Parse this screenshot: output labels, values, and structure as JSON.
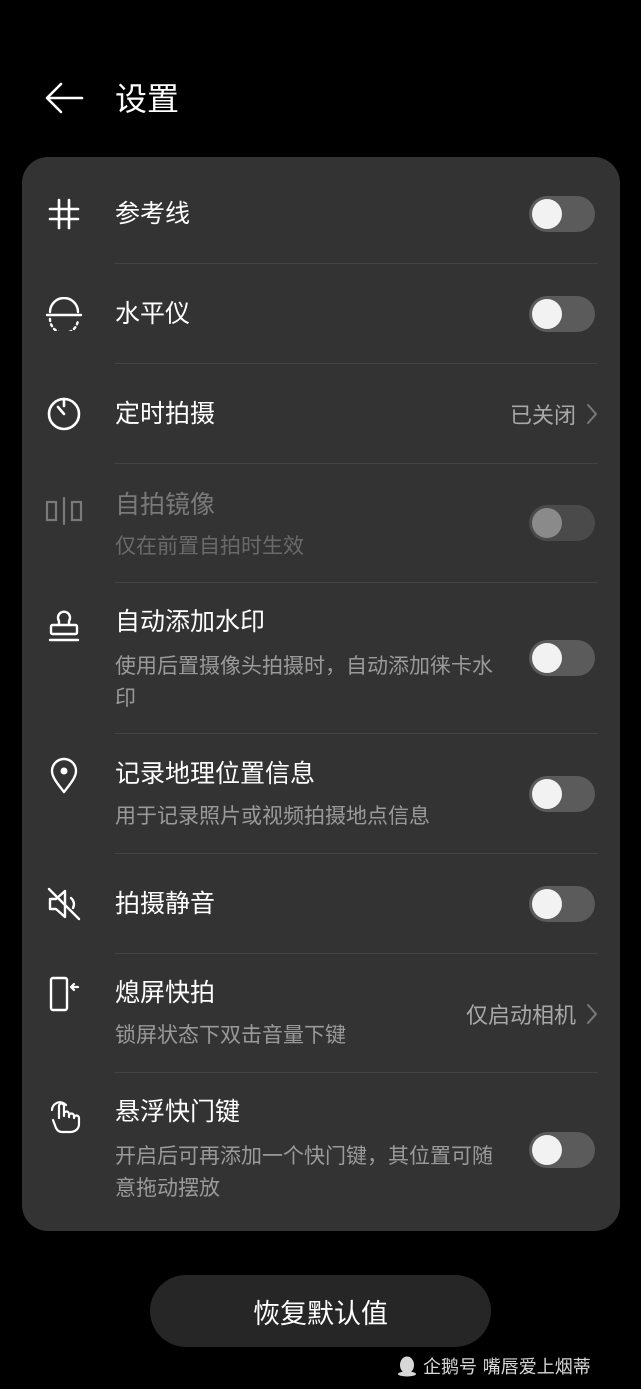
{
  "header": {
    "title": "设置"
  },
  "settings": {
    "reference_lines": {
      "label": "参考线",
      "icon": "grid-icon",
      "enabled": false
    },
    "level": {
      "label": "水平仪",
      "icon": "level-icon",
      "enabled": false
    },
    "timer": {
      "label": "定时拍摄",
      "icon": "timer-icon",
      "value": "已关闭"
    },
    "selfie_mirror": {
      "label": "自拍镜像",
      "sub": "仅在前置自拍时生效",
      "icon": "mirror-icon",
      "enabled": false,
      "disabled": true
    },
    "auto_watermark": {
      "label": "自动添加水印",
      "sub": "使用后置摄像头拍摄时，自动添加徕卡水印",
      "icon": "stamp-icon",
      "enabled": false
    },
    "location": {
      "label": "记录地理位置信息",
      "sub": "用于记录照片或视频拍摄地点信息",
      "icon": "location-pin-icon",
      "enabled": false
    },
    "mute": {
      "label": "拍摄静音",
      "icon": "mute-speaker-icon",
      "enabled": false
    },
    "quick_snap": {
      "label": "熄屏快拍",
      "sub": "锁屏状态下双击音量下键",
      "icon": "phone-side-button-icon",
      "value": "仅启动相机"
    },
    "floating_shutter": {
      "label": "悬浮快门键",
      "sub": "开启后可再添加一个快门键，其位置可随意拖动摆放",
      "icon": "hand-tap-icon",
      "enabled": false
    }
  },
  "footer": {
    "restore_label": "恢复默认值"
  },
  "watermark": {
    "text": "企鹅号 嘴唇爱上烟蒂",
    "icon": "qq-penguin-icon"
  },
  "colors": {
    "background": "#000000",
    "card": "#333333",
    "toggle_off_track": "#5b5b5b",
    "secondary_text": "#9a9a9a"
  }
}
